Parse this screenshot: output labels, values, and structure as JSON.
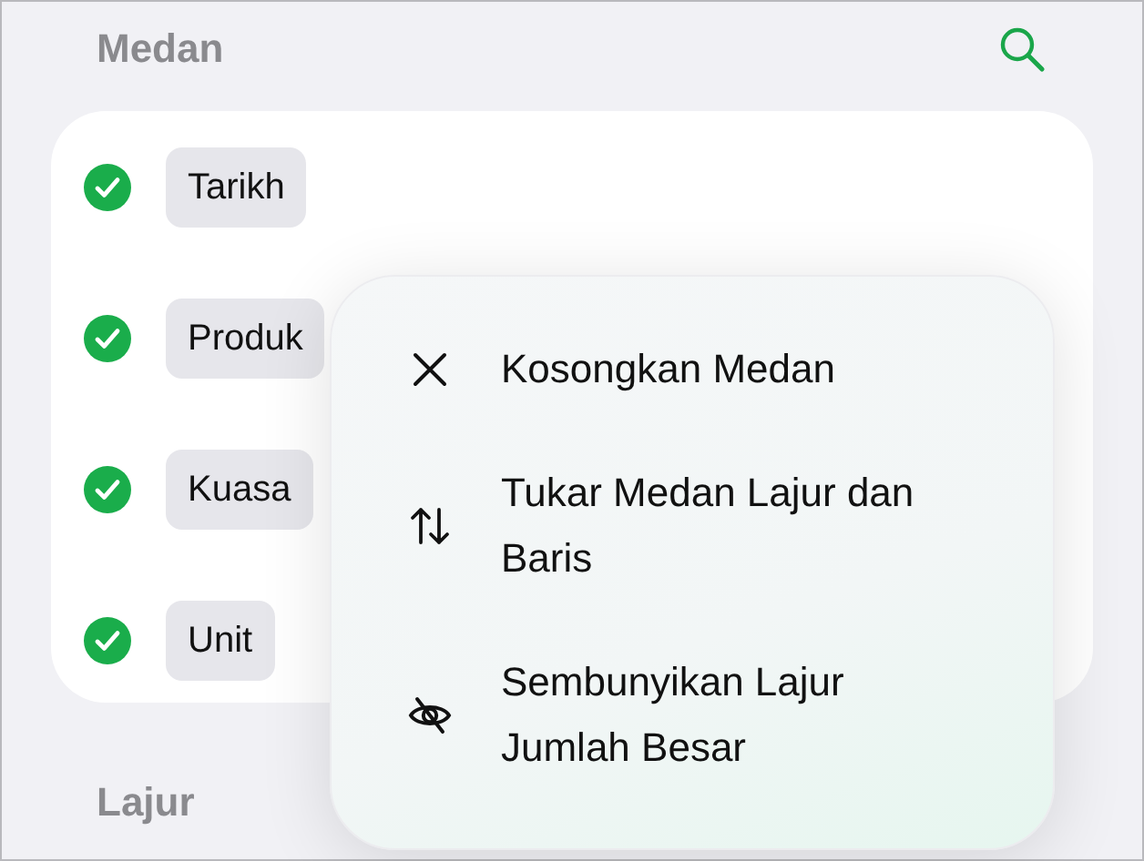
{
  "fields_section": {
    "title": "Medan"
  },
  "fields": [
    {
      "label": "Tarikh",
      "checked": true
    },
    {
      "label": "Produk",
      "checked": true
    },
    {
      "label": "Kuasa",
      "checked": true
    },
    {
      "label": "Unit",
      "checked": true
    }
  ],
  "context_menu": {
    "items": [
      {
        "kind": "clear",
        "label": "Kosongkan Medan"
      },
      {
        "kind": "swap",
        "label": "Tukar Medan Lajur dan Baris"
      },
      {
        "kind": "hide",
        "label": "Sembunyikan Lajur Jumlah Besar"
      }
    ]
  },
  "columns_section": {
    "title": "Lajur"
  }
}
